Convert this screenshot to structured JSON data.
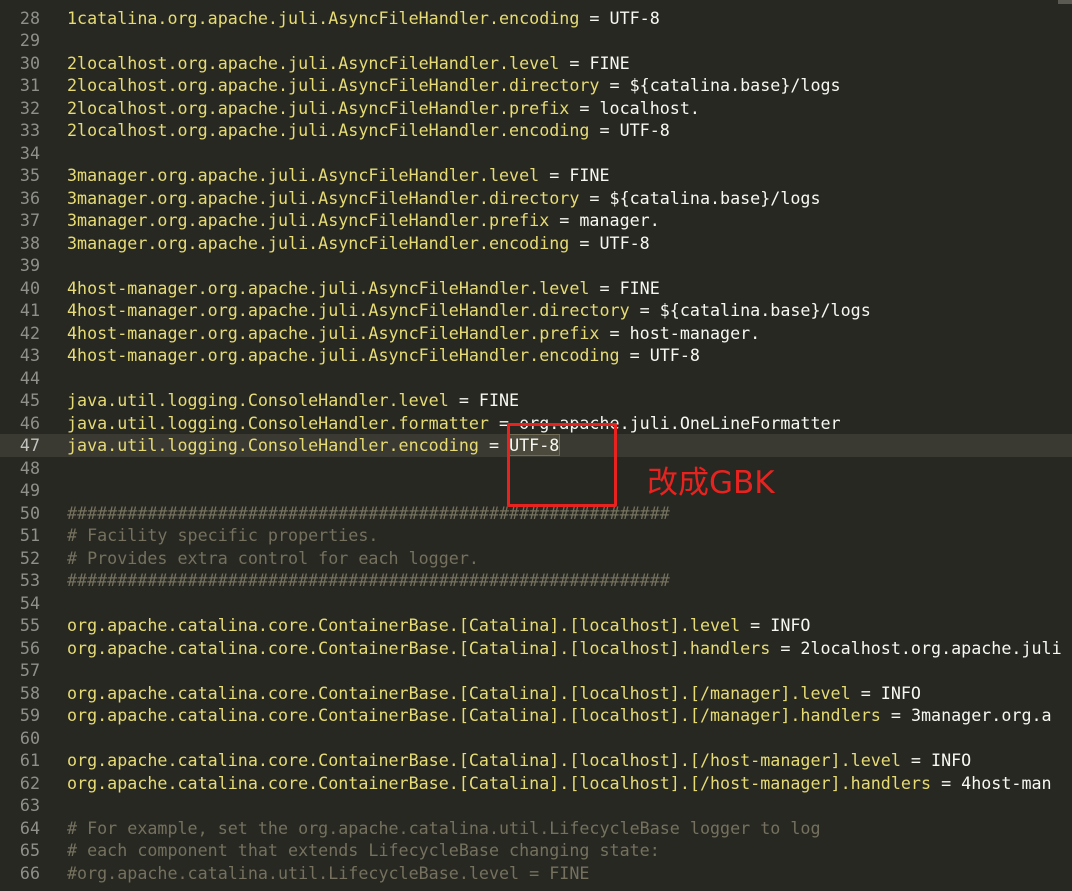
{
  "editor": {
    "theme_colors": {
      "background": "#272822",
      "key": "#e6db74",
      "value": "#f8f8f2",
      "comment": "#75715e",
      "gutter": "#8f908a",
      "annotation": "#e8231f"
    },
    "current_line": 47,
    "lines": [
      {
        "num": "28",
        "type": "prop",
        "key": "1catalina.org.apache.juli.AsyncFileHandler.encoding",
        "value": "UTF-8"
      },
      {
        "num": "29",
        "type": "blank"
      },
      {
        "num": "30",
        "type": "prop",
        "key": "2localhost.org.apache.juli.AsyncFileHandler.level",
        "value": "FINE"
      },
      {
        "num": "31",
        "type": "prop",
        "key": "2localhost.org.apache.juli.AsyncFileHandler.directory",
        "value": "${catalina.base}/logs"
      },
      {
        "num": "32",
        "type": "prop",
        "key": "2localhost.org.apache.juli.AsyncFileHandler.prefix",
        "value": "localhost."
      },
      {
        "num": "33",
        "type": "prop",
        "key": "2localhost.org.apache.juli.AsyncFileHandler.encoding",
        "value": "UTF-8"
      },
      {
        "num": "34",
        "type": "blank"
      },
      {
        "num": "35",
        "type": "prop",
        "key": "3manager.org.apache.juli.AsyncFileHandler.level",
        "value": "FINE"
      },
      {
        "num": "36",
        "type": "prop",
        "key": "3manager.org.apache.juli.AsyncFileHandler.directory",
        "value": "${catalina.base}/logs"
      },
      {
        "num": "37",
        "type": "prop",
        "key": "3manager.org.apache.juli.AsyncFileHandler.prefix",
        "value": "manager."
      },
      {
        "num": "38",
        "type": "prop",
        "key": "3manager.org.apache.juli.AsyncFileHandler.encoding",
        "value": "UTF-8"
      },
      {
        "num": "39",
        "type": "blank"
      },
      {
        "num": "40",
        "type": "prop",
        "key": "4host-manager.org.apache.juli.AsyncFileHandler.level",
        "value": "FINE"
      },
      {
        "num": "41",
        "type": "prop",
        "key": "4host-manager.org.apache.juli.AsyncFileHandler.directory",
        "value": "${catalina.base}/logs"
      },
      {
        "num": "42",
        "type": "prop",
        "key": "4host-manager.org.apache.juli.AsyncFileHandler.prefix",
        "value": "host-manager."
      },
      {
        "num": "43",
        "type": "prop",
        "key": "4host-manager.org.apache.juli.AsyncFileHandler.encoding",
        "value": "UTF-8"
      },
      {
        "num": "44",
        "type": "blank"
      },
      {
        "num": "45",
        "type": "prop",
        "key": "java.util.logging.ConsoleHandler.level",
        "value": "FINE"
      },
      {
        "num": "46",
        "type": "prop",
        "key": "java.util.logging.ConsoleHandler.formatter",
        "value": "org.apache.juli.OneLineFormatter"
      },
      {
        "num": "47",
        "type": "prop",
        "key": "java.util.logging.ConsoleHandler.encoding",
        "value": "UTF-8",
        "highlight": true
      },
      {
        "num": "48",
        "type": "blank"
      },
      {
        "num": "49",
        "type": "blank"
      },
      {
        "num": "50",
        "type": "comment",
        "text": "############################################################"
      },
      {
        "num": "51",
        "type": "comment",
        "text": "# Facility specific properties."
      },
      {
        "num": "52",
        "type": "comment",
        "text": "# Provides extra control for each logger."
      },
      {
        "num": "53",
        "type": "comment",
        "text": "############################################################"
      },
      {
        "num": "54",
        "type": "blank"
      },
      {
        "num": "55",
        "type": "prop",
        "key": "org.apache.catalina.core.ContainerBase.[Catalina].[localhost].level",
        "value": "INFO"
      },
      {
        "num": "56",
        "type": "prop",
        "key": "org.apache.catalina.core.ContainerBase.[Catalina].[localhost].handlers",
        "value": "2localhost.org.apache.juli"
      },
      {
        "num": "57",
        "type": "blank"
      },
      {
        "num": "58",
        "type": "prop",
        "key": "org.apache.catalina.core.ContainerBase.[Catalina].[localhost].[/manager].level",
        "value": "INFO"
      },
      {
        "num": "59",
        "type": "prop",
        "key": "org.apache.catalina.core.ContainerBase.[Catalina].[localhost].[/manager].handlers",
        "value": "3manager.org.a"
      },
      {
        "num": "60",
        "type": "blank"
      },
      {
        "num": "61",
        "type": "prop",
        "key": "org.apache.catalina.core.ContainerBase.[Catalina].[localhost].[/host-manager].level",
        "value": "INFO"
      },
      {
        "num": "62",
        "type": "prop",
        "key": "org.apache.catalina.core.ContainerBase.[Catalina].[localhost].[/host-manager].handlers",
        "value": "4host-man"
      },
      {
        "num": "63",
        "type": "blank"
      },
      {
        "num": "64",
        "type": "comment",
        "text": "# For example, set the org.apache.catalina.util.LifecycleBase logger to log"
      },
      {
        "num": "65",
        "type": "comment",
        "text": "# each component that extends LifecycleBase changing state:"
      },
      {
        "num": "66",
        "type": "comment",
        "text": "#org.apache.catalina.util.LifecycleBase.level = FINE"
      }
    ]
  },
  "annotation": {
    "text": "改成GBK"
  }
}
